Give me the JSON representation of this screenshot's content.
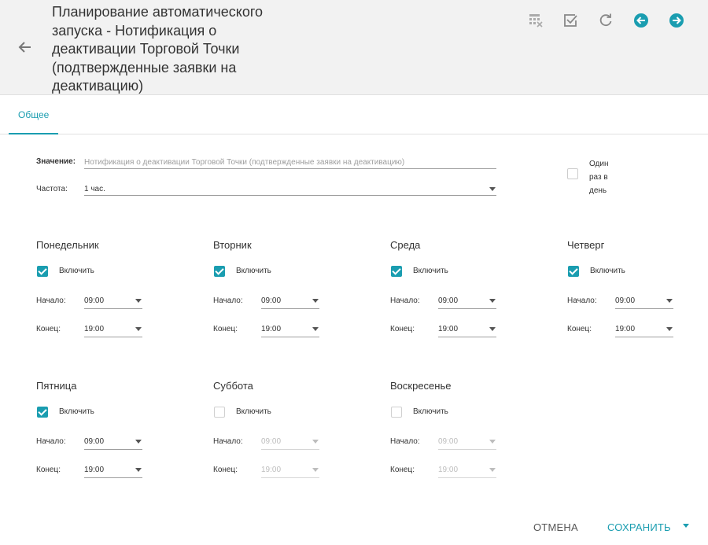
{
  "header": {
    "title": "Планирование автоматического запуска - Нотификация о деактивации Торговой Точки (подтвержденные заявки на деактивацию)",
    "icons": [
      "back-arrow-icon",
      "table-clear-icon",
      "check-box-icon",
      "refresh-icon",
      "arrow-left-circle-icon",
      "arrow-right-circle-icon"
    ],
    "accent_color": "#1a9db0"
  },
  "tabs": [
    {
      "label": "Общее",
      "active": true
    }
  ],
  "form": {
    "value_label": "Значение:",
    "value_text": "Нотификация о деактивации Торговой Точки (подтвержденные заявки на деактивацию)",
    "frequency_label": "Частота:",
    "frequency_value": "1 час.",
    "once_a_day_label": "Один раз в день",
    "once_a_day_checked": false
  },
  "days": [
    {
      "name": "Понедельник",
      "enable_label": "Включить",
      "enabled": true,
      "start_label": "Начало:",
      "start": "09:00",
      "end_label": "Конец:",
      "end": "19:00"
    },
    {
      "name": "Вторник",
      "enable_label": "Включить",
      "enabled": true,
      "start_label": "Начало:",
      "start": "09:00",
      "end_label": "Конец:",
      "end": "19:00"
    },
    {
      "name": "Среда",
      "enable_label": "Включить",
      "enabled": true,
      "start_label": "Начало:",
      "start": "09:00",
      "end_label": "Конец:",
      "end": "19:00"
    },
    {
      "name": "Четверг",
      "enable_label": "Включить",
      "enabled": true,
      "start_label": "Начало:",
      "start": "09:00",
      "end_label": "Конец:",
      "end": "19:00"
    },
    {
      "name": "Пятница",
      "enable_label": "Включить",
      "enabled": true,
      "start_label": "Начало:",
      "start": "09:00",
      "end_label": "Конец:",
      "end": "19:00"
    },
    {
      "name": "Суббота",
      "enable_label": "Включить",
      "enabled": false,
      "start_label": "Начало:",
      "start": "09:00",
      "end_label": "Конец:",
      "end": "19:00"
    },
    {
      "name": "Воскресенье",
      "enable_label": "Включить",
      "enabled": false,
      "start_label": "Начало:",
      "start": "09:00",
      "end_label": "Конец:",
      "end": "19:00"
    }
  ],
  "footer": {
    "cancel_label": "ОТМЕНА",
    "save_label": "СОХРАНИТЬ"
  }
}
